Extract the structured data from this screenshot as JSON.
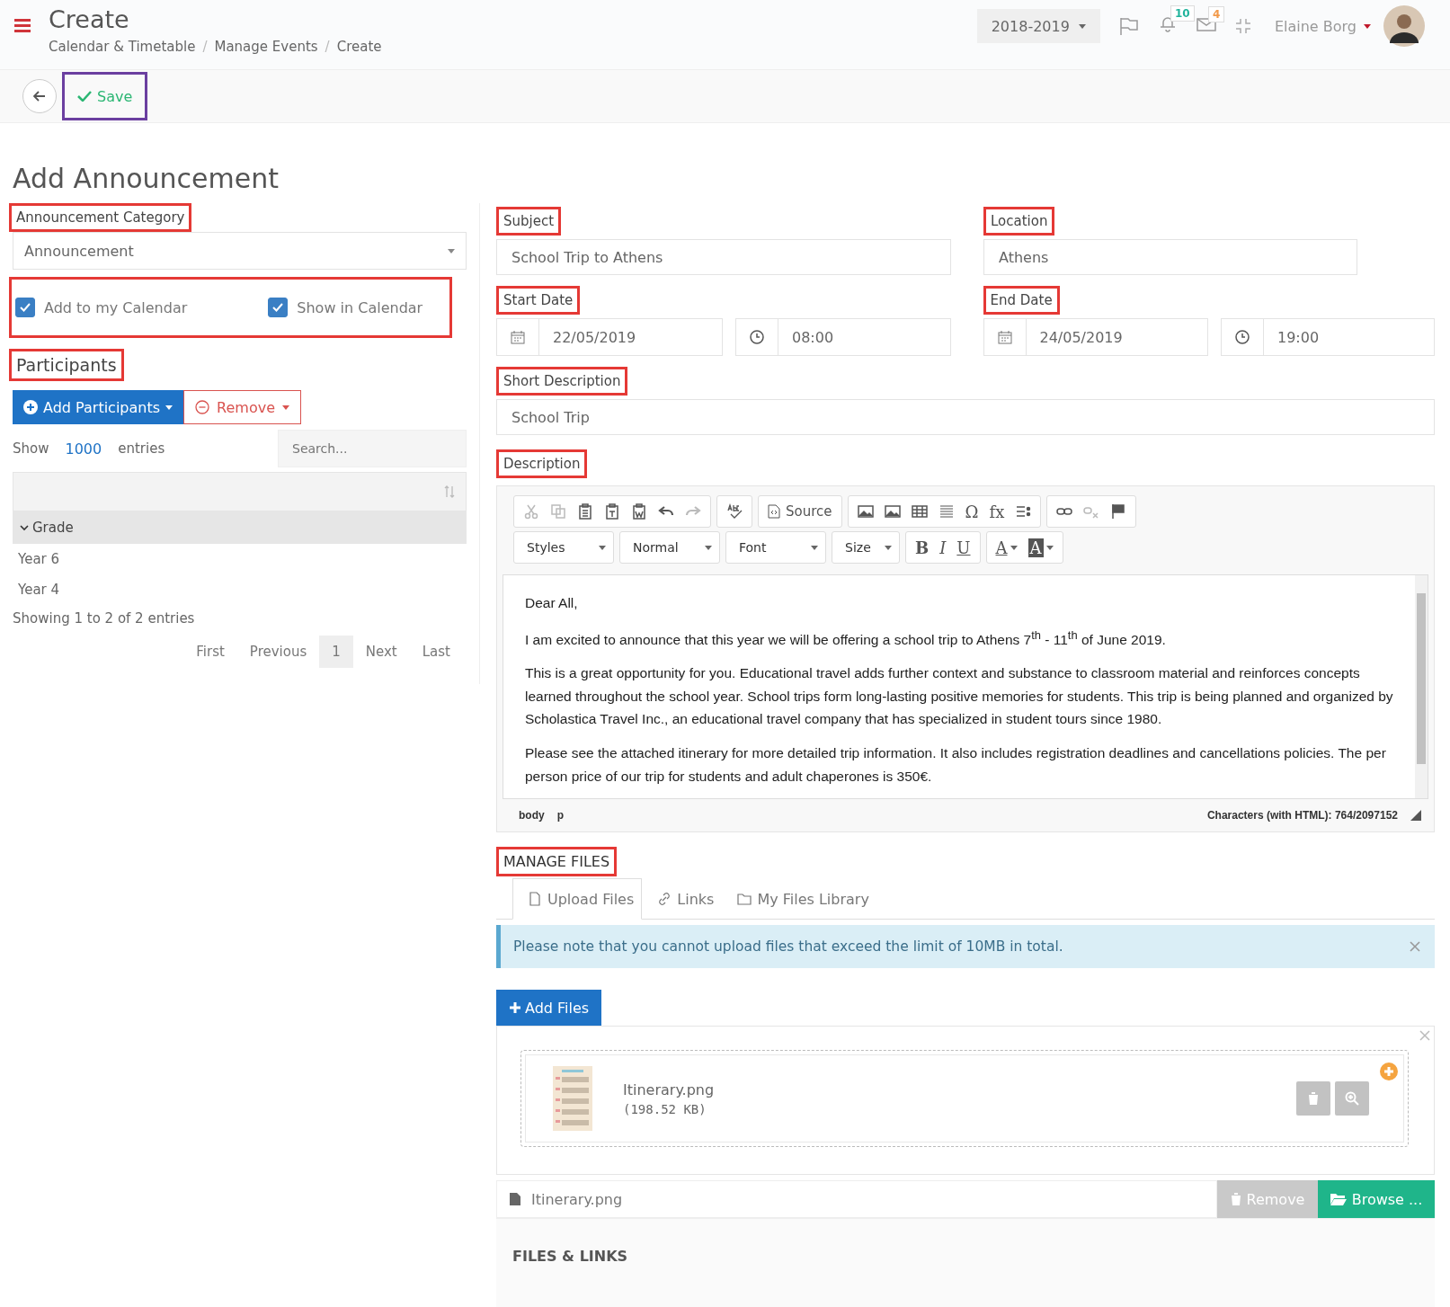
{
  "header": {
    "title": "Create",
    "breadcrumbs": [
      "Calendar & Timetable",
      "Manage Events",
      "Create"
    ],
    "breadcrumb_separator": "/",
    "year": "2018-2019",
    "notification_count": "10",
    "message_count": "4",
    "user": "Elaine Borg"
  },
  "toolbar": {
    "save": {
      "label": "Save",
      "annotated": true
    }
  },
  "page_title": "Add Announcement",
  "category": {
    "label": "Announcement Category",
    "annotated": true,
    "value": "Announcement"
  },
  "calendar_options": {
    "annotated": true,
    "items": [
      {
        "label": "Add to my Calendar",
        "checked": true
      },
      {
        "label": "Show in Calendar",
        "checked": true
      }
    ]
  },
  "participants": {
    "label": "Participants",
    "annotated": true,
    "add_button": "Add Participants",
    "remove_button": "Remove",
    "show_label": "Show",
    "page_size": "1000",
    "entries_label": "entries",
    "search_placeholder": "Search...",
    "group": {
      "label": "Grade",
      "expanded": true,
      "rows": [
        "Year 6",
        "Year 4"
      ]
    },
    "info": "Showing 1 to 2 of 2 entries",
    "pager": [
      {
        "label": "First",
        "selected": false
      },
      {
        "label": "Previous",
        "selected": false
      },
      {
        "label": "1",
        "selected": true
      },
      {
        "label": "Next",
        "selected": false
      },
      {
        "label": "Last",
        "selected": false
      }
    ]
  },
  "subject": {
    "label": "Subject",
    "annotated": true,
    "value": "School Trip to Athens"
  },
  "location": {
    "label": "Location",
    "annotated": true,
    "value": "Athens"
  },
  "start": {
    "label": "Start Date",
    "annotated": true,
    "date": "22/05/2019",
    "time": "08:00"
  },
  "end": {
    "label": "End Date",
    "annotated": true,
    "date": "24/05/2019",
    "time": "19:00"
  },
  "short_description": {
    "label": "Short Description",
    "annotated": true,
    "value": "School Trip"
  },
  "description": {
    "label": "Description",
    "annotated": true,
    "toolbar": [
      [
        {
          "kind": "icon",
          "disabled": true
        },
        {
          "kind": "icon",
          "disabled": true
        },
        {
          "kind": "icon",
          "disabled": false
        },
        {
          "kind": "icon",
          "disabled": false
        },
        {
          "kind": "icon",
          "disabled": false
        },
        {
          "kind": "icon",
          "disabled": false
        },
        {
          "kind": "icon",
          "disabled": true
        }
      ],
      [
        {
          "kind": "icon",
          "disabled": false
        }
      ],
      [
        {
          "kind": "text",
          "label": "Source"
        }
      ],
      [
        {
          "kind": "icon",
          "disabled": false
        },
        {
          "kind": "icon",
          "disabled": false
        },
        {
          "kind": "icon",
          "disabled": false
        },
        {
          "kind": "icon",
          "disabled": false
        },
        {
          "kind": "glyph",
          "label": "Ω",
          "disabled": false
        },
        {
          "kind": "glyph",
          "label": "fx",
          "disabled": false
        },
        {
          "kind": "icon",
          "disabled": false
        }
      ],
      [
        {
          "kind": "icon",
          "disabled": false
        },
        {
          "kind": "icon",
          "disabled": true
        },
        {
          "kind": "icon",
          "disabled": false
        }
      ]
    ],
    "dropdowns": [
      "Styles",
      "Normal",
      "Font",
      "Size"
    ],
    "formatting": [
      {
        "label": "B",
        "kind": "bold"
      },
      {
        "label": "I",
        "kind": "italic"
      },
      {
        "label": "U",
        "kind": "underline"
      }
    ],
    "colors": [
      "A",
      "A"
    ],
    "paragraphs": [
      "Dear All,",
      "I am excited to announce that this year we will be offering a school trip to Athens 7$^{th}$ - 11$^{th}$ of June 2019.",
      "This is a great opportunity for you. Educational travel adds further context and substance to classroom material and reinforces concepts learned throughout the school year. School trips form long-lasting positive memories for students. This trip is being planned and organized by Scholastica Travel Inc., an educational travel company that has specialized in student tours since 1980.",
      "Please see the attached itinerary for more detailed trip information. It also includes registration deadlines and cancellations policies. The per person price of our trip for students and adult chaperones is 350€."
    ],
    "path": [
      "body",
      "p"
    ],
    "char_count": "Characters (with HTML): 764/2097152"
  },
  "files": {
    "label": "MANAGE FILES",
    "annotated": true,
    "tabs": [
      {
        "label": "Upload Files",
        "selected": true
      },
      {
        "label": "Links",
        "selected": false
      },
      {
        "label": "My Files Library",
        "selected": false
      }
    ],
    "alert": "Please note that you cannot upload files that exceed the limit of 10MB in total.",
    "add_button": "Add Files",
    "file_name": "Itinerary.png",
    "file_size": "(198.52 KB)",
    "input_value": "Itinerary.png",
    "remove_button": "Remove",
    "browse_button": "Browse ..."
  },
  "files_links": "FILES & LINKS"
}
